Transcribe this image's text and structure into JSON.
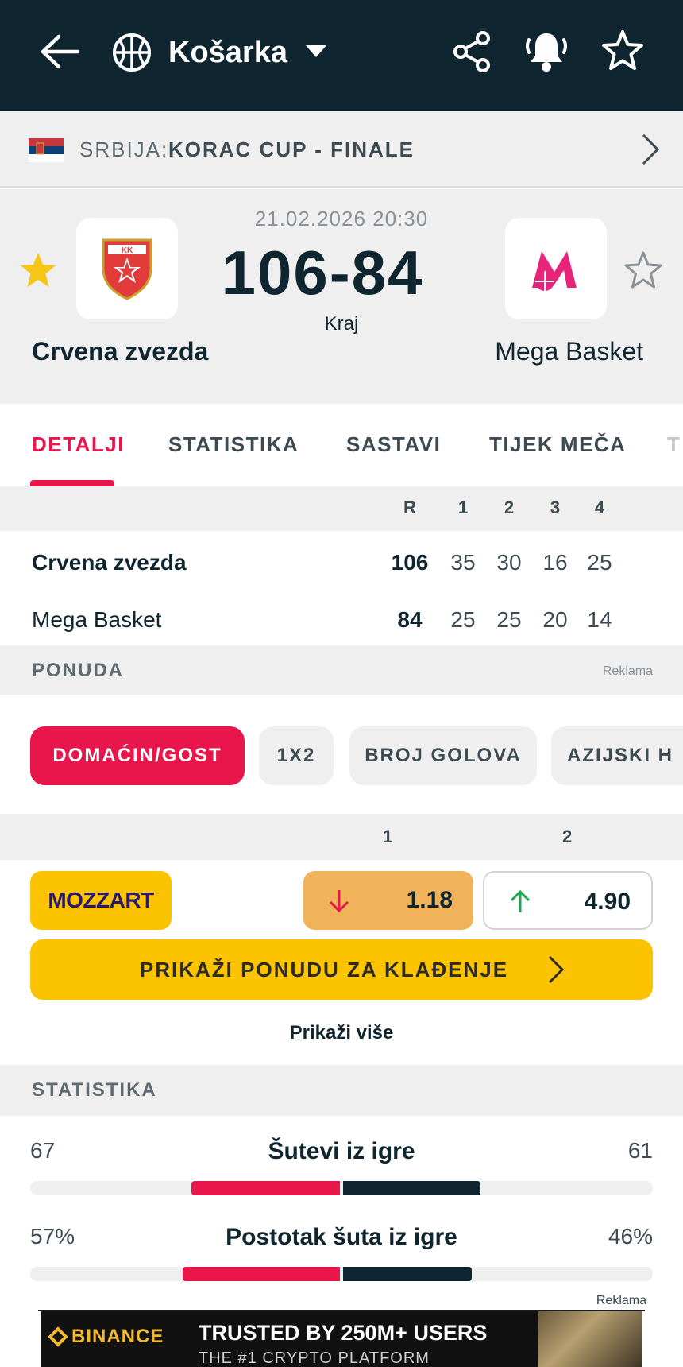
{
  "topbar": {
    "sport_label": "Košarka",
    "icons": [
      "back-arrow-icon",
      "basketball-icon",
      "dropdown-caret-icon",
      "share-icon",
      "bell-icon",
      "star-outline-icon"
    ]
  },
  "league": {
    "country": "SRBIJA:",
    "name": "KORAC CUP - FINALE"
  },
  "match": {
    "datetime": "21.02.2026 20:30",
    "score": "106-84",
    "status": "Kraj",
    "home_team": "Crvena zvezda",
    "away_team": "Mega Basket",
    "home_favorited": true,
    "away_favorited": false
  },
  "tabs": [
    "DETALJI",
    "STATISTIKA",
    "SASTAVI",
    "TIJEK MEČA",
    "T"
  ],
  "score_table": {
    "headers": [
      "R",
      "1",
      "2",
      "3",
      "4"
    ],
    "rows": [
      {
        "team": "Crvena zvezda",
        "values": [
          "106",
          "35",
          "30",
          "16",
          "25"
        ]
      },
      {
        "team": "Mega Basket",
        "values": [
          "84",
          "25",
          "25",
          "20",
          "14"
        ]
      }
    ]
  },
  "offer": {
    "title": "PONUDA",
    "ad_label": "Reklama",
    "chips": [
      "DOMAĆIN/GOST",
      "1X2",
      "BROJ GOLOVA",
      "AZIJSKI H"
    ],
    "columns": [
      "1",
      "2"
    ],
    "bookmaker": "MOZZART",
    "odds": [
      {
        "value": "1.18",
        "trend": "down"
      },
      {
        "value": "4.90",
        "trend": "up"
      }
    ],
    "cta": "PRIKAŽI PONUDU ZA KLAĐENJE",
    "show_more": "Prikaži više"
  },
  "statistics": {
    "title": "STATISTIKA",
    "items": [
      {
        "label": "Šutevi iz igre",
        "home": "67",
        "away": "61",
        "home_share": 0.52,
        "away_share": 0.48
      },
      {
        "label": "Postotak šuta iz igre",
        "home": "57%",
        "away": "46%",
        "home_share": 0.55,
        "away_share": 0.45
      }
    ]
  },
  "ad": {
    "label": "Reklama",
    "brand": "BINANCE",
    "headline": "TRUSTED BY 250M+ USERS",
    "sub": "THE #1 CRYPTO PLATFORM"
  },
  "colors": {
    "header_bg": "#0f2530",
    "accent": "#e8164b",
    "bookie_yellow": "#fcc300",
    "odd_down_bg": "#f0b35a",
    "down_arrow": "#e8164b",
    "up_arrow": "#1fa84f"
  }
}
